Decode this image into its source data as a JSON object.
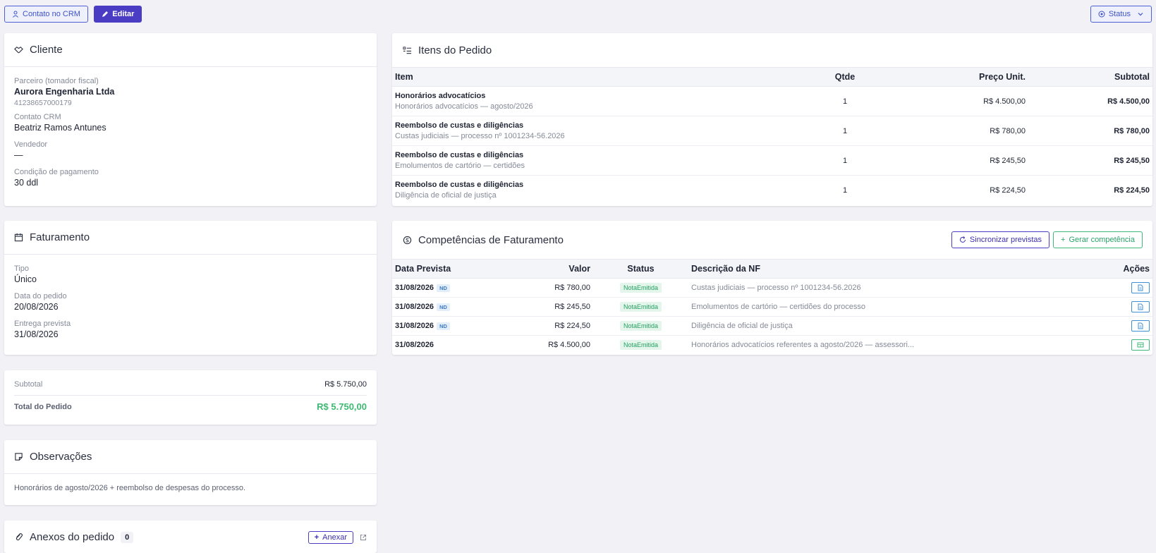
{
  "toolbar": {
    "crm_label": "Contato no CRM",
    "edit_label": "Editar",
    "status_label": "Status"
  },
  "cliente": {
    "title": "Cliente",
    "partner_label": "Parceiro (tomador fiscal)",
    "partner_name": "Aurora Engenharia Ltda",
    "partner_doc": "41238657000179",
    "contact_label": "Contato CRM",
    "contact_value": "Beatriz Ramos Antunes",
    "seller_label": "Vendedor",
    "seller_value": "—",
    "payment_label": "Condição de pagamento",
    "payment_value": "30 ddl"
  },
  "faturamento": {
    "title": "Faturamento",
    "type_label": "Tipo",
    "type_value": "Único",
    "order_date_label": "Data do pedido",
    "order_date_value": "20/08/2026",
    "delivery_label": "Entrega prevista",
    "delivery_value": "31/08/2026"
  },
  "totals": {
    "subtotal_label": "Subtotal",
    "subtotal_value": "R$ 5.750,00",
    "total_label": "Total do Pedido",
    "total_value": "R$ 5.750,00"
  },
  "observacoes": {
    "title": "Observações",
    "text": "Honorários de agosto/2026 + reembolso de despesas do processo."
  },
  "anexos": {
    "title": "Anexos do pedido",
    "count": "0",
    "attach_label": "Anexar"
  },
  "itens": {
    "title": "Itens do Pedido",
    "columns": [
      "Item",
      "Qtde",
      "Preço Unit.",
      "Subtotal"
    ],
    "rows": [
      {
        "name": "Honorários advocatícios",
        "desc": "Honorários advocatícios — agosto/2026",
        "qty": "1",
        "unit": "R$ 4.500,00",
        "subtotal": "R$ 4.500,00"
      },
      {
        "name": "Reembolso de custas e diligências",
        "desc": "Custas judiciais — processo nº 1001234-56.2026",
        "qty": "1",
        "unit": "R$ 780,00",
        "subtotal": "R$ 780,00"
      },
      {
        "name": "Reembolso de custas e diligências",
        "desc": "Emolumentos de cartório — certidões",
        "qty": "1",
        "unit": "R$ 245,50",
        "subtotal": "R$ 245,50"
      },
      {
        "name": "Reembolso de custas e diligências",
        "desc": "Diligência de oficial de justiça",
        "qty": "1",
        "unit": "R$ 224,50",
        "subtotal": "R$ 224,50"
      }
    ]
  },
  "competencias": {
    "title": "Competências de Faturamento",
    "sync_label": "Sincronizar previstas",
    "generate_label": "Gerar competência",
    "columns": [
      "Data Prevista",
      "Valor",
      "Status",
      "Descrição da NF",
      "Ações"
    ],
    "rows": [
      {
        "date": "31/08/2026",
        "tag": "ND",
        "value": "R$ 780,00",
        "status": "NotaEmitida",
        "desc": "Custas judiciais — processo nº 1001234-56.2026"
      },
      {
        "date": "31/08/2026",
        "tag": "ND",
        "value": "R$ 245,50",
        "status": "NotaEmitida",
        "desc": "Emolumentos de cartório — certidões do processo"
      },
      {
        "date": "31/08/2026",
        "tag": "ND",
        "value": "R$ 224,50",
        "status": "NotaEmitida",
        "desc": "Diligência de oficial de justiça"
      },
      {
        "date": "31/08/2026",
        "tag": "",
        "value": "R$ 4.500,00",
        "status": "NotaEmitida",
        "desc": "Honorários advocatícios referentes a agosto/2026 — assessori..."
      }
    ]
  },
  "colors": {
    "primary": "#4b3cc4",
    "success": "#2aa368",
    "total_green": "#3cba72"
  }
}
